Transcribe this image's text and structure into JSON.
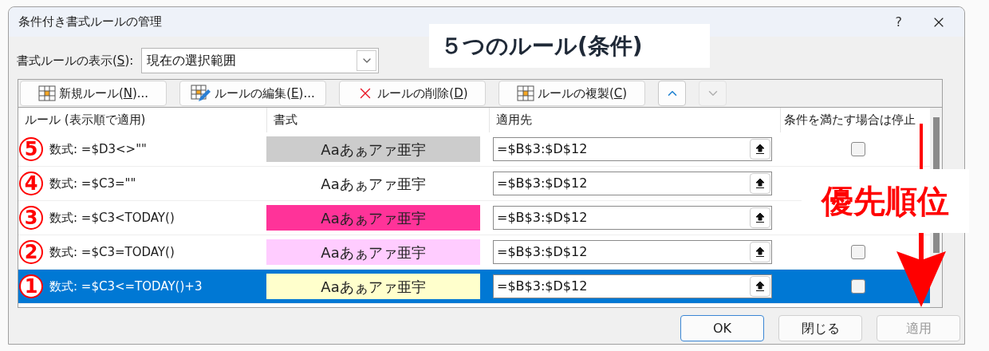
{
  "window": {
    "title": "条件付き書式ルールの管理",
    "help": "?"
  },
  "show_rules": {
    "label_before": "書式ルールの表示(",
    "label_key": "S",
    "label_after": "):",
    "value": "現在の選択範囲"
  },
  "toolbar": [
    {
      "kind": "new",
      "before": "新規ルール(",
      "key": "N",
      "after": ")...",
      "disabled": false
    },
    {
      "kind": "edit",
      "before": "ルールの編集(",
      "key": "E",
      "after": ")...",
      "disabled": false
    },
    {
      "kind": "delete",
      "before": "ルールの削除(",
      "key": "D",
      "after": ")",
      "disabled": false
    },
    {
      "kind": "duplicate",
      "before": "ルールの複製(",
      "key": "C",
      "after": ")",
      "disabled": false
    },
    {
      "kind": "up",
      "disabled": false
    },
    {
      "kind": "down",
      "disabled": true
    }
  ],
  "table": {
    "columns": [
      "ルール (表示順で適用)",
      "書式",
      "適用先",
      "条件を満たす場合は停止"
    ],
    "rows": [
      {
        "marker": "5",
        "rule": "数式: =$D3<>\"\"",
        "preview": "Aaあぁアァ亜宇",
        "color": "#cccccc",
        "applies_to": "=$B$3:$D$12",
        "stop_if_true": false,
        "selected": false
      },
      {
        "marker": "4",
        "rule": "数式: =$C3=\"\"",
        "preview": "Aaあぁアァ亜宇",
        "color": "#ffffff",
        "applies_to": "=$B$3:$D$12",
        "selected": false
      },
      {
        "marker": "3",
        "rule": "数式: =$C3<TODAY()",
        "preview": "Aaあぁアァ亜宇",
        "color": "#ff3399",
        "applies_to": "=$B$3:$D$12",
        "selected": false
      },
      {
        "marker": "2",
        "rule": "数式: =$C3=TODAY()",
        "preview": "Aaあぁアァ亜宇",
        "color": "#ffccff",
        "applies_to": "=$B$3:$D$12",
        "stop_if_true": false,
        "selected": false
      },
      {
        "marker": "1",
        "rule": "数式: =$C3<=TODAY()+3",
        "preview": "Aaあぁアァ亜宇",
        "color": "#ffffcc",
        "applies_to": "=$B$3:$D$12",
        "stop_if_true": false,
        "selected": true
      }
    ]
  },
  "buttons": [
    {
      "label": "OK",
      "default": true,
      "disabled": false
    },
    {
      "label": "閉じる",
      "default": false,
      "disabled": false
    },
    {
      "label": "適用",
      "default": false,
      "disabled": true
    }
  ],
  "annotations": {
    "title": "５つのルール(条件)",
    "priority": "優先順位"
  }
}
